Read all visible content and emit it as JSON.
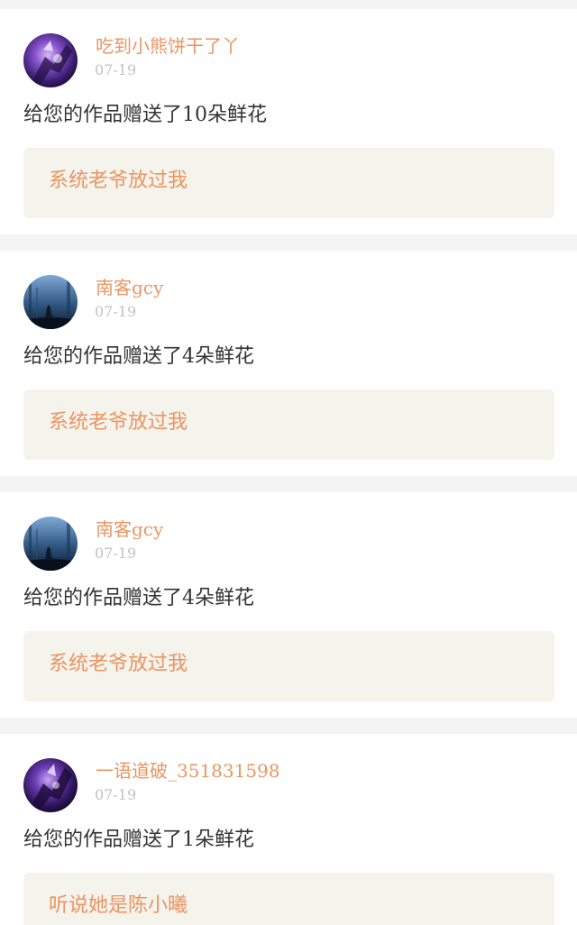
{
  "posts": [
    {
      "username": "吃到小熊饼干了丫",
      "date": "07-19",
      "message": "给您的作品赠送了10朵鲜花",
      "reply": "系统老爷放过我",
      "avatar_icon": "purple-warrior-avatar"
    },
    {
      "username": "南客gcy",
      "date": "07-19",
      "message": "给您的作品赠送了4朵鲜花",
      "reply": "系统老爷放过我",
      "avatar_icon": "wolf-forest-avatar"
    },
    {
      "username": "南客gcy",
      "date": "07-19",
      "message": "给您的作品赠送了4朵鲜花",
      "reply": "系统老爷放过我",
      "avatar_icon": "wolf-forest-avatar"
    },
    {
      "username": "一语道破_351831598",
      "date": "07-19",
      "message": "给您的作品赠送了1朵鲜花",
      "reply": "听说她是陈小曦",
      "avatar_icon": "purple-warrior-avatar"
    }
  ],
  "colors": {
    "accent": "#ea9563",
    "date": "#c2c2c2",
    "text": "#333333",
    "reply_bg": "#f4f3ec",
    "page_bg": "#f4f4f4",
    "card_bg": "#ffffff"
  }
}
